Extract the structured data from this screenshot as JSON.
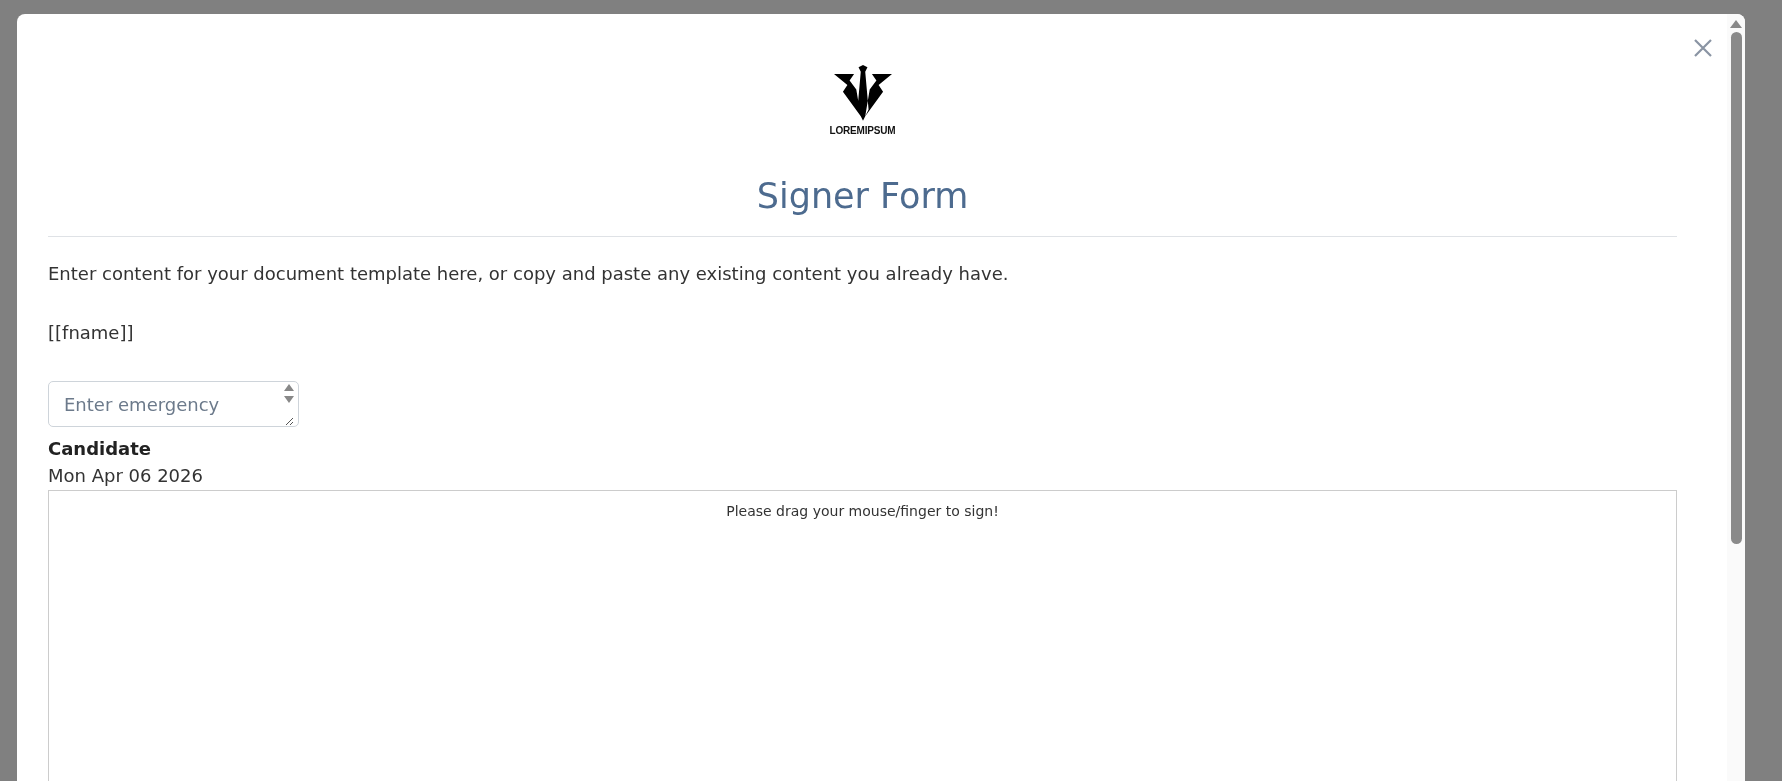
{
  "logo": {
    "text": "LOREMIPSUM"
  },
  "title": "Signer Form",
  "intro": "Enter content for your document template here, or copy and paste any existing content you already have.",
  "placeholder_tag": "[[fname]]",
  "emergency_field": {
    "placeholder": "Enter emergency"
  },
  "signer": {
    "role": "Candidate",
    "date": "Mon Apr 06 2026"
  },
  "signature_pad": {
    "hint": "Please drag your mouse/finger to sign!"
  }
}
